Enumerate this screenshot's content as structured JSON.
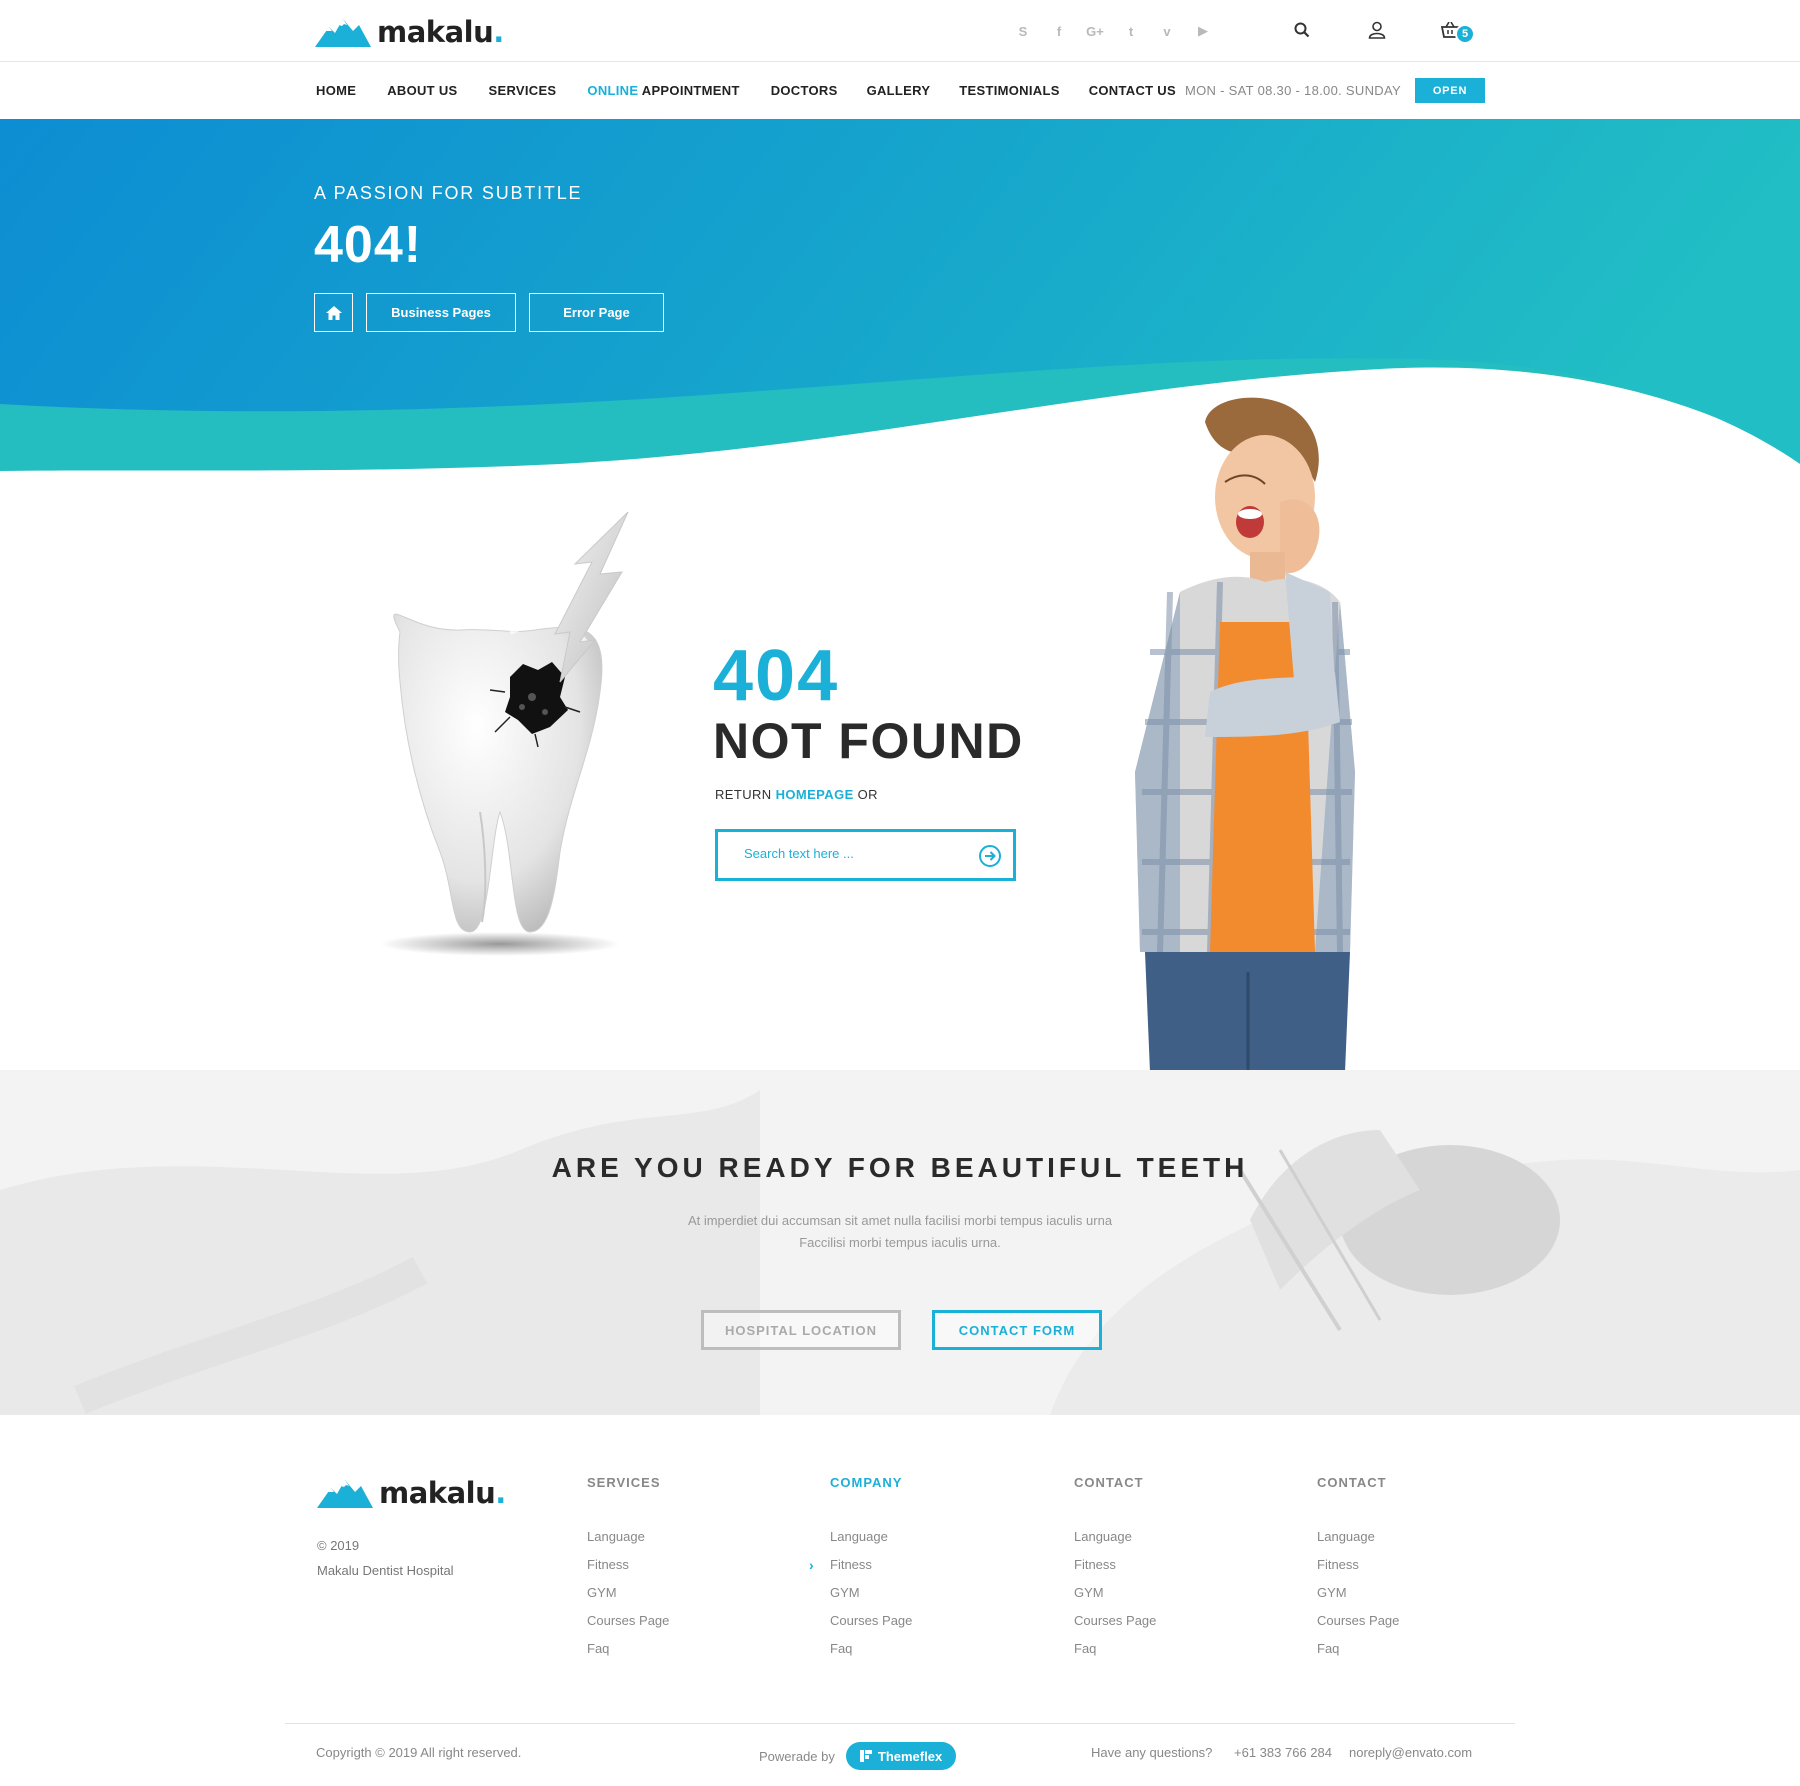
{
  "brand": {
    "name": "makalu",
    "dot": ".",
    "accent": "#1ab0d8"
  },
  "header": {
    "socials": [
      {
        "icon": "skype-icon",
        "glyph": "S"
      },
      {
        "icon": "facebook-icon",
        "glyph": "f"
      },
      {
        "icon": "google-plus-icon",
        "glyph": "G+"
      },
      {
        "icon": "twitter-icon",
        "glyph": "t"
      },
      {
        "icon": "vimeo-icon",
        "glyph": "v"
      },
      {
        "icon": "youtube-icon",
        "glyph": "▶"
      }
    ],
    "cart_count": "5"
  },
  "nav": {
    "items": [
      {
        "label": "HOME"
      },
      {
        "label": "ABOUT US"
      },
      {
        "label": "SERVICES"
      },
      {
        "label_highlight": "ONLINE",
        "label": " APPOINTMENT"
      },
      {
        "label": "DOCTORS"
      },
      {
        "label": "GALLERY"
      },
      {
        "label": "TESTIMONIALS"
      },
      {
        "label": "CONTACT US"
      }
    ],
    "hours": "MON - SAT 08.30 - 18.00. SUNDAY",
    "status": "OPEN"
  },
  "hero": {
    "subtitle": "A PASSION FOR SUBTITLE",
    "title": "404!",
    "breadcrumbs": [
      "Business Pages",
      "Error Page"
    ]
  },
  "error": {
    "code": "404",
    "title": "NOT FOUND",
    "return_prefix": "RETURN ",
    "return_link": "HOMEPAGE",
    "return_suffix": " OR",
    "search_placeholder": "Search text here ..."
  },
  "cta": {
    "title": "ARE YOU READY FOR BEAUTIFUL TEETH",
    "line1": "At imperdiet dui accumsan sit amet nulla facilisi morbi tempus iaculis urna",
    "line2": "Faccilisi morbi tempus iaculis urna.",
    "btn_location": "HOSPITAL LOCATION",
    "btn_contact": "CONTACT FORM"
  },
  "footer": {
    "copyright_year": "© 2019",
    "org": "Makalu Dentist Hospital",
    "columns": [
      {
        "title": "SERVICES",
        "links": [
          "Language",
          "Fitness",
          "GYM",
          "Courses Page",
          "Faq"
        ]
      },
      {
        "title": "COMPANY",
        "links": [
          "Language",
          "Fitness",
          "GYM",
          "Courses Page",
          "Faq"
        ]
      },
      {
        "title": "CONTACT",
        "links": [
          "Language",
          "Fitness",
          "GYM",
          "Courses Page",
          "Faq"
        ]
      },
      {
        "title": "CONTACT",
        "links": [
          "Language",
          "Fitness",
          "GYM",
          "Courses Page",
          "Faq"
        ]
      }
    ],
    "copyright": "Copyrigth © 2019 All right reserved.",
    "powered_label": "Powerade by",
    "powered_brand": "Themeflex",
    "question": "Have any questions?",
    "phone": "+61 383 766 284",
    "email": "noreply@envato.com"
  }
}
